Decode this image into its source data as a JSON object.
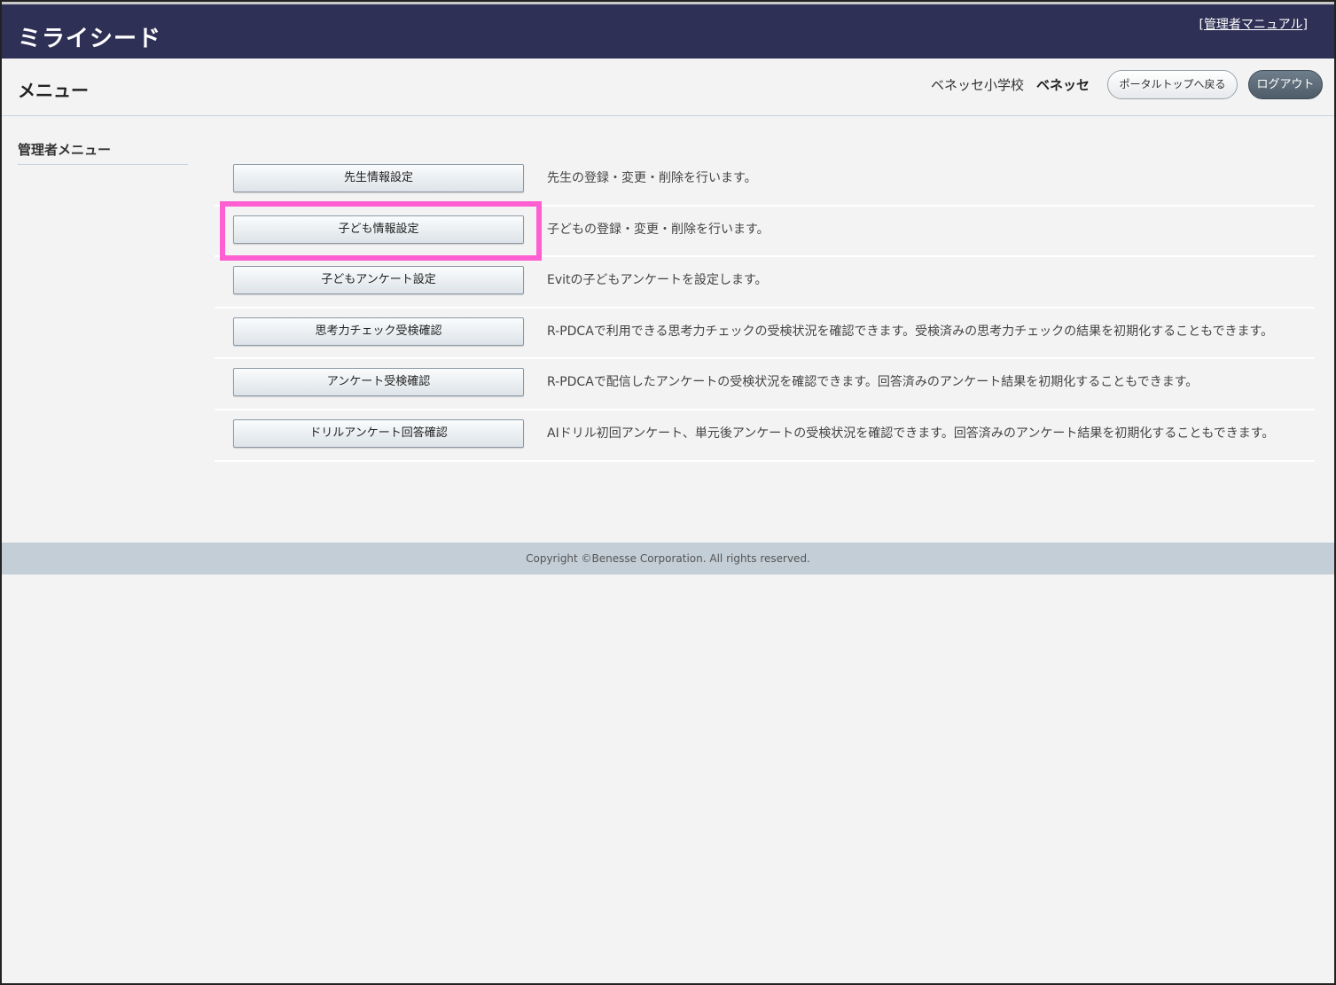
{
  "header": {
    "logo_text": "ミライシード",
    "manual_bracket_open": "[",
    "manual_link": "管理者マニュアル",
    "manual_bracket_close": "]"
  },
  "subheader": {
    "title": "メニュー",
    "school": "ベネッセ小学校",
    "user": "ベネッセ",
    "portal_button": "ポータルトップへ戻る",
    "logout_button": "ログアウト"
  },
  "sidebar": {
    "title": "管理者メニュー"
  },
  "menu": {
    "items": [
      {
        "label": "先生情報設定",
        "desc": "先生の登録・変更・削除を行います。"
      },
      {
        "label": "子ども情報設定",
        "desc": "子どもの登録・変更・削除を行います。"
      },
      {
        "label": "子どもアンケート設定",
        "desc": "Evitの子どもアンケートを設定します。"
      },
      {
        "label": "思考力チェック受検確認",
        "desc": "R-PDCAで利用できる思考力チェックの受検状況を確認できます。受検済みの思考力チェックの結果を初期化することもできます。"
      },
      {
        "label": "アンケート受検確認",
        "desc": "R-PDCAで配信したアンケートの受検状況を確認できます。回答済みのアンケート結果を初期化することもできます。"
      },
      {
        "label": "ドリルアンケート回答確認",
        "desc": "AIドリル初回アンケート、単元後アンケートの受検状況を確認できます。回答済みのアンケート結果を初期化することもできます。"
      }
    ]
  },
  "footer": {
    "copyright": "Copyright ©Benesse Corporation. All rights reserved."
  },
  "colors": {
    "topbar": "#2f3055",
    "highlight": "#ff5fd0",
    "footer": "#c3ced7"
  }
}
